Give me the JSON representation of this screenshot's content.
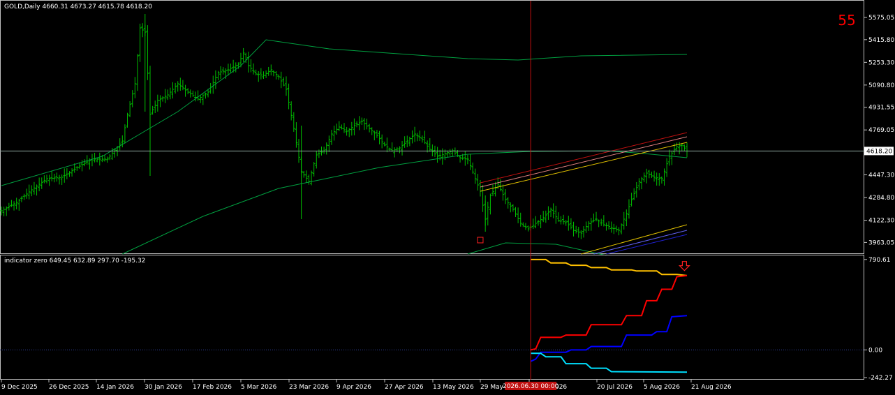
{
  "main_header": "GOLD,Daily  4660.31 4673.27 4615.78 4618.20",
  "main_counter": "55",
  "sub_header": "indicator zero 649.45 632.89 297.70 -195.32",
  "current_price_label": "4618.20",
  "cursor_label": "2026.06.30 00:00",
  "colors": {
    "background": "#000000",
    "candles": "#00c000",
    "grid_frame": "#c0c0c0",
    "price_line": "#8fa8a0",
    "cursor": "#c01010",
    "counter": "#ff0000",
    "channel_red": "#c01010",
    "channel_yellow": "#e0c000",
    "channel_blue": "#2020d0",
    "ind_yellow": "#ffc000",
    "ind_red": "#ff0000",
    "ind_blue": "#0000ff",
    "ind_cyan": "#00e0ff"
  },
  "chart_data": [
    {
      "type": "candlestick-ohlc",
      "symbol": "GOLD",
      "timeframe": "Daily",
      "ohlc_last": {
        "open": 4660.31,
        "high": 4673.27,
        "low": 4615.78,
        "close": 4618.2
      },
      "ylim": [
        3880,
        5690
      ],
      "y_ticks": [
        "5575.05",
        "5415.80",
        "5253.30",
        "5090.80",
        "4931.55",
        "4769.05",
        "4447.30",
        "4284.80",
        "4122.30",
        "3963.05"
      ],
      "x_ticks": [
        "9 Dec 2025",
        "26 Dec 2025",
        "14 Jan 2026",
        "30 Jan 2026",
        "17 Feb 2026",
        "5 Mar 2026",
        "23 Mar 2026",
        "9 Apr 2026",
        "27 Apr 2026",
        "13 May 2026",
        "29 May 2026",
        "16 Jun 2026",
        "",
        "20 Jul 2026",
        "5 Aug 2026",
        "21 Aug 2026"
      ],
      "close_path": [
        [
          0,
          4190
        ],
        [
          6,
          4250
        ],
        [
          12,
          4340
        ],
        [
          18,
          4420
        ],
        [
          24,
          4430
        ],
        [
          30,
          4500
        ],
        [
          36,
          4560
        ],
        [
          42,
          4560
        ],
        [
          48,
          4690
        ],
        [
          50,
          4880
        ],
        [
          53,
          5100
        ],
        [
          55,
          5500
        ],
        [
          57,
          5470
        ],
        [
          59,
          4880
        ],
        [
          62,
          4980
        ],
        [
          66,
          5020
        ],
        [
          70,
          5100
        ],
        [
          74,
          5040
        ],
        [
          78,
          4990
        ],
        [
          82,
          5040
        ],
        [
          86,
          5180
        ],
        [
          90,
          5200
        ],
        [
          94,
          5240
        ],
        [
          96,
          5320
        ],
        [
          98,
          5230
        ],
        [
          101,
          5170
        ],
        [
          104,
          5160
        ],
        [
          107,
          5200
        ],
        [
          110,
          5150
        ],
        [
          113,
          5060
        ],
        [
          116,
          4780
        ],
        [
          119,
          4470
        ],
        [
          122,
          4400
        ],
        [
          125,
          4590
        ],
        [
          128,
          4620
        ],
        [
          131,
          4740
        ],
        [
          134,
          4790
        ],
        [
          137,
          4760
        ],
        [
          140,
          4800
        ],
        [
          143,
          4830
        ],
        [
          146,
          4780
        ],
        [
          149,
          4730
        ],
        [
          152,
          4660
        ],
        [
          155,
          4620
        ],
        [
          158,
          4640
        ],
        [
          161,
          4690
        ],
        [
          164,
          4740
        ],
        [
          167,
          4700
        ],
        [
          170,
          4630
        ],
        [
          173,
          4580
        ],
        [
          176,
          4600
        ],
        [
          179,
          4620
        ],
        [
          182,
          4570
        ],
        [
          185,
          4560
        ],
        [
          188,
          4420
        ],
        [
          190,
          4330
        ],
        [
          192,
          4130
        ],
        [
          194,
          4300
        ],
        [
          197,
          4380
        ],
        [
          200,
          4270
        ],
        [
          203,
          4200
        ],
        [
          206,
          4100
        ],
        [
          209,
          4060
        ],
        [
          212,
          4100
        ],
        [
          215,
          4140
        ],
        [
          218,
          4200
        ],
        [
          221,
          4120
        ],
        [
          224,
          4110
        ],
        [
          227,
          4050
        ],
        [
          230,
          4030
        ],
        [
          233,
          4100
        ],
        [
          236,
          4130
        ],
        [
          239,
          4090
        ],
        [
          242,
          4070
        ],
        [
          245,
          4050
        ],
        [
          248,
          4170
        ],
        [
          250,
          4270
        ],
        [
          253,
          4400
        ],
        [
          256,
          4460
        ],
        [
          259,
          4430
        ],
        [
          262,
          4420
        ],
        [
          265,
          4580
        ],
        [
          268,
          4650
        ],
        [
          270,
          4660
        ],
        [
          272,
          4618
        ]
      ],
      "bars": 273,
      "overlays": [
        {
          "kind": "ma",
          "color": "#00a040",
          "points": [
            [
              0,
              4370
            ],
            [
              40,
              4580
            ],
            [
              70,
              4900
            ],
            [
              95,
              5230
            ],
            [
              105,
              5415
            ],
            [
              130,
              5350
            ],
            [
              185,
              5280
            ],
            [
              205,
              5270
            ],
            [
              230,
              5300
            ],
            [
              272,
              5310
            ]
          ]
        },
        {
          "kind": "ma",
          "color": "#00a040",
          "points": [
            [
              48,
              3880
            ],
            [
              80,
              4150
            ],
            [
              110,
              4350
            ],
            [
              150,
              4500
            ],
            [
              185,
              4595
            ],
            [
              210,
              4615
            ],
            [
              240,
              4620
            ],
            [
              255,
              4600
            ],
            [
              272,
              4570
            ]
          ]
        },
        {
          "kind": "ma",
          "color": "#00a040",
          "points": [
            [
              185,
              3880
            ],
            [
              200,
              3960
            ],
            [
              220,
              3950
            ],
            [
              240,
              3870
            ]
          ]
        }
      ],
      "channel_lines": [
        {
          "color": "#c01010",
          "x": [
            190,
            272
          ],
          "y": [
            4390,
            4750
          ]
        },
        {
          "color": "#e08080",
          "x": [
            190,
            272
          ],
          "y": [
            4360,
            4720
          ]
        },
        {
          "color": "#e0c000",
          "x": [
            190,
            272
          ],
          "y": [
            4330,
            4680
          ]
        },
        {
          "color": "#e0c000",
          "x": [
            230,
            272
          ],
          "y": [
            3880,
            4090
          ]
        },
        {
          "color": "#6060f0",
          "x": [
            235,
            272
          ],
          "y": [
            3880,
            4050
          ]
        },
        {
          "color": "#2020d0",
          "x": [
            240,
            272
          ],
          "y": [
            3880,
            4020
          ]
        }
      ],
      "current_price": 4618.2,
      "cursor_bar": 210,
      "marker": {
        "bar": 190,
        "price": 3980
      }
    },
    {
      "type": "line",
      "name": "indicator zero",
      "values_last": [
        649.45,
        632.89,
        297.7,
        -195.32
      ],
      "ylim": [
        -260,
        820
      ],
      "y_ticks": [
        "790.61",
        "0.00",
        "-242.27"
      ],
      "zero_level": 0,
      "start_bar": 210,
      "series": [
        {
          "color": "#ffc000",
          "points": [
            [
              210,
              790
            ],
            [
              216,
              790
            ],
            [
              218,
              760
            ],
            [
              224,
              760
            ],
            [
              226,
              740
            ],
            [
              232,
              740
            ],
            [
              234,
              720
            ],
            [
              240,
              720
            ],
            [
              242,
              700
            ],
            [
              250,
              700
            ],
            [
              252,
              690
            ],
            [
              260,
              690
            ],
            [
              262,
              660
            ],
            [
              268,
              660
            ],
            [
              272,
              650
            ]
          ]
        },
        {
          "color": "#ff0000",
          "points": [
            [
              210,
              0
            ],
            [
              212,
              10
            ],
            [
              214,
              110
            ],
            [
              222,
              110
            ],
            [
              224,
              130
            ],
            [
              232,
              130
            ],
            [
              234,
              220
            ],
            [
              246,
              220
            ],
            [
              248,
              300
            ],
            [
              254,
              300
            ],
            [
              256,
              430
            ],
            [
              260,
              430
            ],
            [
              262,
              530
            ],
            [
              266,
              530
            ],
            [
              268,
              640
            ],
            [
              272,
              650
            ]
          ]
        },
        {
          "color": "#0000ff",
          "points": [
            [
              210,
              -100
            ],
            [
              212,
              -80
            ],
            [
              214,
              -20
            ],
            [
              224,
              -20
            ],
            [
              226,
              0
            ],
            [
              232,
              0
            ],
            [
              234,
              30
            ],
            [
              246,
              30
            ],
            [
              248,
              130
            ],
            [
              258,
              130
            ],
            [
              260,
              160
            ],
            [
              264,
              160
            ],
            [
              266,
              290
            ],
            [
              272,
              300
            ]
          ]
        },
        {
          "color": "#00e0ff",
          "points": [
            [
              210,
              -30
            ],
            [
              214,
              -30
            ],
            [
              216,
              -60
            ],
            [
              222,
              -60
            ],
            [
              224,
              -120
            ],
            [
              232,
              -120
            ],
            [
              234,
              -160
            ],
            [
              240,
              -160
            ],
            [
              242,
              -190
            ],
            [
              272,
              -195
            ]
          ]
        }
      ],
      "arrow_marker": {
        "bar": 271,
        "value": 700
      }
    }
  ]
}
